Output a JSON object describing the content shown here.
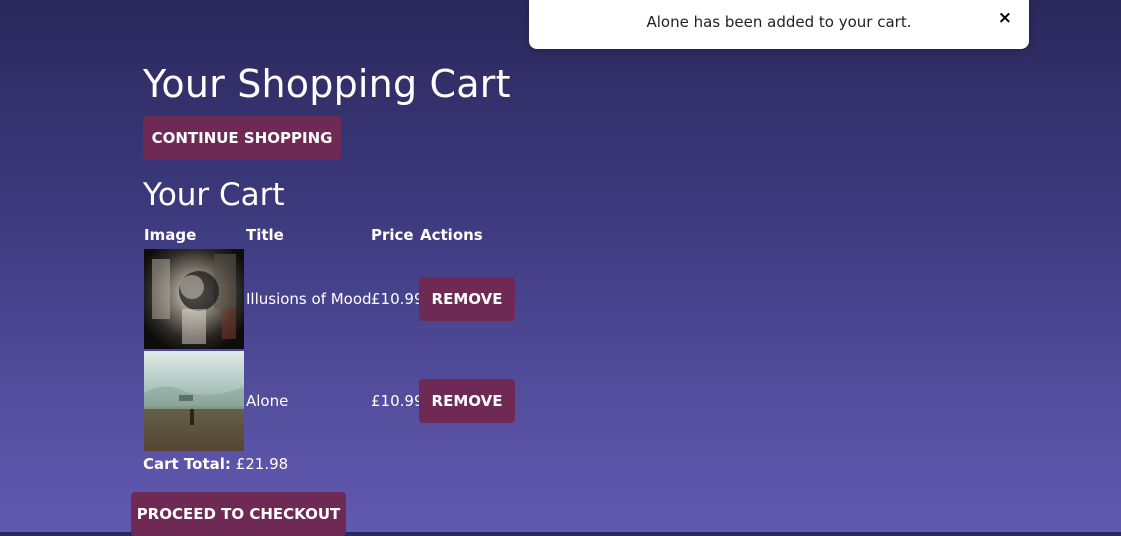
{
  "toast": {
    "message": "Alone has been added to your cart.",
    "close_label": "×"
  },
  "page": {
    "title": "Your Shopping Cart",
    "continue_label": "CONTINUE SHOPPING",
    "cart_heading": "Your Cart",
    "checkout_label": "PROCEED TO CHECKOUT"
  },
  "table": {
    "headers": [
      "Image",
      "Title",
      "Price",
      "Actions"
    ],
    "rows": [
      {
        "title": "Illusions of Mood",
        "price": "£10.99",
        "action": "REMOVE",
        "image": "abstract-moody-artwork"
      },
      {
        "title": "Alone",
        "price": "£10.99",
        "action": "REMOVE",
        "image": "misty-field-landscape"
      }
    ]
  },
  "summary": {
    "total_label": "Cart Total:",
    "total_value": "£21.98"
  },
  "colors": {
    "button": "#6e2a55",
    "background_top": "#2b285c",
    "background_bottom": "#6158b0",
    "toast_bg": "#ffffff"
  }
}
